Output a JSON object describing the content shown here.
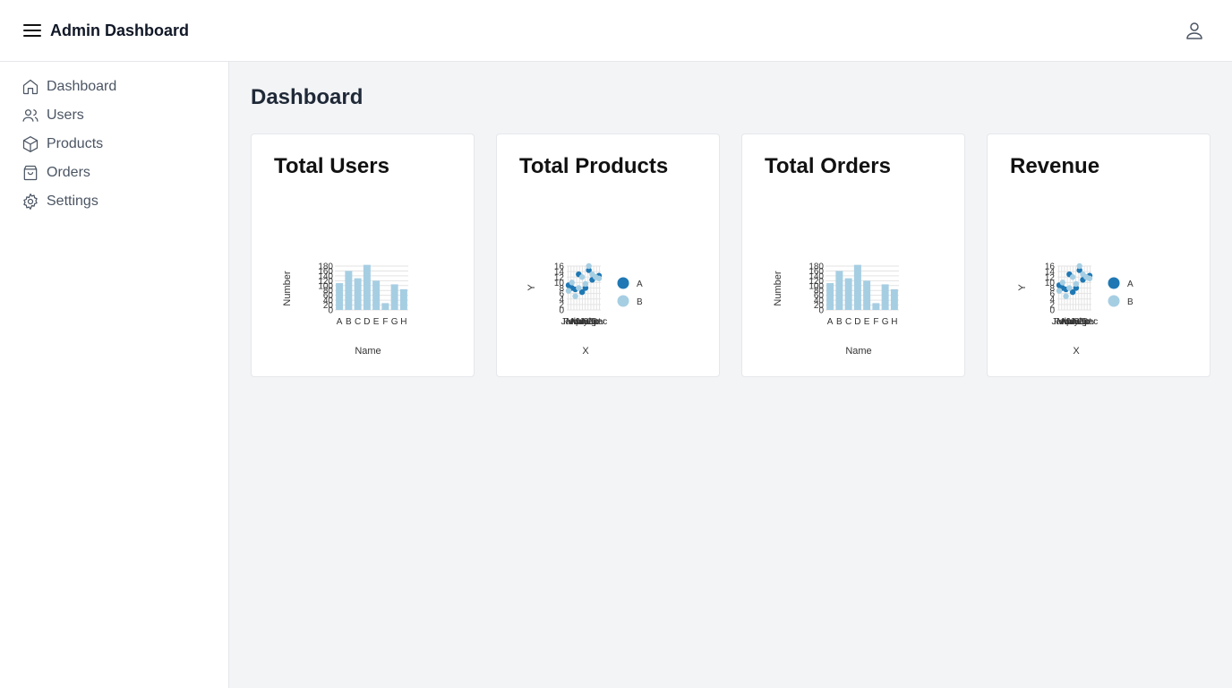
{
  "header": {
    "title": "Admin Dashboard"
  },
  "sidebar": {
    "items": [
      {
        "label": "Dashboard",
        "icon": "home-icon"
      },
      {
        "label": "Users",
        "icon": "users-icon"
      },
      {
        "label": "Products",
        "icon": "cube-icon"
      },
      {
        "label": "Orders",
        "icon": "shopping-bag-icon"
      },
      {
        "label": "Settings",
        "icon": "gear-icon"
      }
    ]
  },
  "main": {
    "title": "Dashboard"
  },
  "colors": {
    "dark": "#1f78b4",
    "light": "#a6cee3"
  },
  "cards": [
    {
      "title": "Total Users"
    },
    {
      "title": "Total Products"
    },
    {
      "title": "Total Orders"
    },
    {
      "title": "Revenue"
    }
  ],
  "chart_data": [
    {
      "type": "bar",
      "categories": [
        "A",
        "B",
        "C",
        "D",
        "E",
        "F",
        "G",
        "H"
      ],
      "values": [
        110,
        160,
        130,
        185,
        120,
        28,
        105,
        85
      ],
      "xlabel": "Name",
      "ylabel": "Number",
      "ylim": [
        0,
        180
      ],
      "yticks": [
        0,
        20,
        40,
        60,
        80,
        100,
        120,
        140,
        160,
        180
      ]
    },
    {
      "type": "scatter",
      "xlabel": "X",
      "ylabel": "Y",
      "ylim": [
        0,
        16
      ],
      "yticks": [
        0,
        2,
        4,
        6,
        8,
        10,
        12,
        14,
        16
      ],
      "xticks": [
        "Jan",
        "Feb",
        "Mar",
        "Apr",
        "May",
        "Jun",
        "Jul",
        "Aug",
        "Sep",
        "Oct",
        "Nov",
        "Dec"
      ],
      "legend": [
        "A",
        "B"
      ],
      "series": [
        {
          "name": "A",
          "values": [
            9,
            8,
            7.5,
            13,
            6.5,
            8,
            14.5,
            11,
            12,
            12.5
          ]
        },
        {
          "name": "B",
          "values": [
            7,
            10,
            5,
            8,
            12,
            9.5,
            16,
            13,
            12,
            11.5
          ]
        }
      ]
    },
    {
      "type": "bar",
      "categories": [
        "A",
        "B",
        "C",
        "D",
        "E",
        "F",
        "G",
        "H"
      ],
      "values": [
        110,
        160,
        130,
        185,
        120,
        28,
        105,
        85
      ],
      "xlabel": "Name",
      "ylabel": "Number",
      "ylim": [
        0,
        180
      ],
      "yticks": [
        0,
        20,
        40,
        60,
        80,
        100,
        120,
        140,
        160,
        180
      ]
    },
    {
      "type": "scatter",
      "xlabel": "X",
      "ylabel": "Y",
      "ylim": [
        0,
        16
      ],
      "yticks": [
        0,
        2,
        4,
        6,
        8,
        10,
        12,
        14,
        16
      ],
      "xticks": [
        "Jan",
        "Feb",
        "Mar",
        "Apr",
        "May",
        "Jun",
        "Jul",
        "Aug",
        "Sep",
        "Oct",
        "Nov",
        "Dec"
      ],
      "legend": [
        "A",
        "B"
      ],
      "series": [
        {
          "name": "A",
          "values": [
            9,
            8,
            7.5,
            13,
            6.5,
            8,
            14.5,
            11,
            12,
            12.5
          ]
        },
        {
          "name": "B",
          "values": [
            7,
            10,
            5,
            8,
            12,
            9.5,
            16,
            13,
            12,
            11.5
          ]
        }
      ]
    }
  ]
}
